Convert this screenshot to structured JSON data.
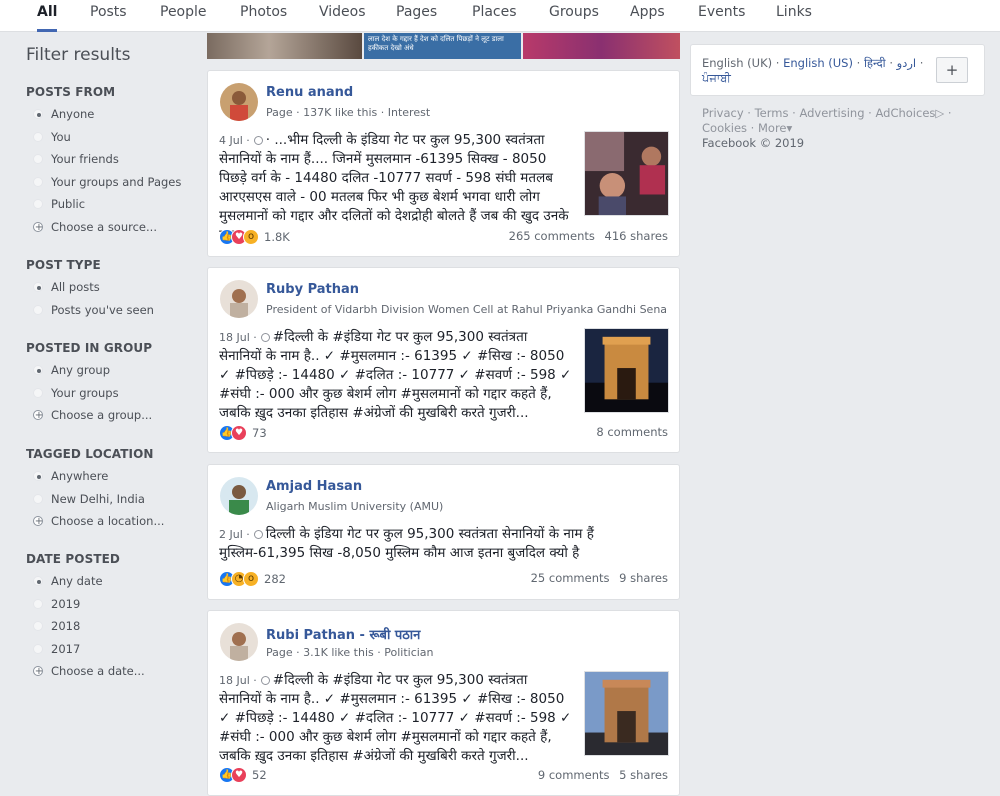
{
  "topnav": {
    "tabs": [
      "All",
      "Posts",
      "People",
      "Photos",
      "Videos",
      "Pages",
      "Places",
      "Groups",
      "Apps",
      "Events",
      "Links"
    ],
    "active": "All"
  },
  "sidebar": {
    "title": "Filter results",
    "posts_from": {
      "heading": "POSTS FROM",
      "options": [
        "Anyone",
        "You",
        "Your friends",
        "Your groups and Pages",
        "Public"
      ],
      "choose": "Choose a source..."
    },
    "post_type": {
      "heading": "POST TYPE",
      "options": [
        "All posts",
        "Posts you've seen"
      ]
    },
    "posted_in_group": {
      "heading": "POSTED IN GROUP",
      "options": [
        "Any group",
        "Your groups"
      ],
      "choose": "Choose a group..."
    },
    "tagged_location": {
      "heading": "TAGGED LOCATION",
      "options": [
        "Anywhere",
        "New Delhi, India"
      ],
      "choose": "Choose a location..."
    },
    "date_posted": {
      "heading": "DATE POSTED",
      "options": [
        "Any date",
        "2019",
        "2018",
        "2017"
      ],
      "choose": "Choose a date..."
    }
  },
  "banner": {
    "text": "लाल देश के गद्दार हैं देश को दलित पिछड़ों ने लूट डाला हकीकत देखो अंधे"
  },
  "posts": [
    {
      "name": "Renu anand",
      "meta": "Page · 137K like this · Interest",
      "date": "4 Jul ·",
      "text": "· ...भीम दिल्ली के इंडिया गेट पर कुल 95,300 स्वतंत्रता सेनानियों के नाम हैं.... जिनमें मुसलमान -61395 सिक्ख - 8050 पिछड़े वर्ग के - 14480 दलित -10777 सवर्ण - 598 संघी मतलब आरएसएस वाले - 00 मतलब फिर भी कुछ बेशर्म भगवा धारी लोग मुसलमानों को गद्दार और दलितों को देशद्रोही बोलते हैं जब की खुद उनके बाप...",
      "reaction_count": "1.8K",
      "comments": "265 comments",
      "shares": "416 shares"
    },
    {
      "name": "Ruby Pathan",
      "meta": "President of Vidarbh Division Women Cell at Rahul Priyanka Gandhi Sena",
      "date": "18 Jul ·",
      "text": "#दिल्ली के #इंडिया गेट पर कुल 95,300 स्वतंत्रता सेनानियों के नाम है.. ✓ #मुसलमान :- 61395 ✓ #सिख :- 8050 ✓ #पिछड़े :- 14480 ✓ #दलित :- 10777 ✓ #सवर्ण :- 598 ✓ #संघी :- 000 और कुछ बेशर्म लोग #मुसलमानों को गद्दार कहते हैं, जबकि ख़ुद उनका इतिहास #अंग्रेजों की मुखबिरी करते गुजरी...",
      "reaction_count": "73",
      "comments": "8 comments",
      "shares": ""
    },
    {
      "name": "Amjad Hasan",
      "meta": "Aligarh Muslim University (AMU)",
      "date": "2 Jul ·",
      "text": "दिल्ली के इंडिया गेट पर कुल 95,300 स्वतंत्रता सेनानियों के नाम हैं मुस्लिम-61,395 सिख -8,050 मुस्लिम कौम आज इतना बुजदिल क्यो है",
      "reaction_count": "282",
      "comments": "25 comments",
      "shares": "9 shares"
    },
    {
      "name": "Rubi Pathan - रूबी पठान",
      "meta": "Page · 3.1K like this · Politician",
      "date": "18 Jul ·",
      "text": "#दिल्ली के #इंडिया गेट पर कुल 95,300 स्वतंत्रता सेनानियों के नाम है.. ✓ #मुसलमान :- 61395 ✓ #सिख :- 8050 ✓ #पिछड़े :- 14480 ✓ #दलित :- 10777 ✓ #सवर्ण :- 598 ✓ #संघी :- 000 और कुछ बेशर्म लोग #मुसलमानों को गद्दार कहते हैं, जबकि ख़ुद उनका इतिहास #अंग्रेजों की मुखबिरी करते गुजरी...",
      "reaction_count": "52",
      "comments": "9 comments",
      "shares": "5 shares"
    }
  ],
  "rightcol": {
    "languages": {
      "current": "English (UK)",
      "sep1": " · ",
      "us": "English (US)",
      "sep2": " · ",
      "hindi": "हिन्दी",
      "sep3": " · ",
      "urdu": "اردو",
      "sep4": " ·",
      "punjabi": "ਪੰਜਾਬੀ"
    },
    "add_label": "+",
    "footer": {
      "privacy": "Privacy",
      "terms": "Terms",
      "advertising": "Advertising",
      "adchoices": "AdChoices",
      "adchoices_icon": "▷",
      "cookies": "Cookies",
      "more": "More",
      "more_caret": "▾",
      "copyright": "Facebook © 2019"
    }
  },
  "icons": {
    "accent": "#4267b2",
    "link": "#365899",
    "like": "#1877f2",
    "love": "#e9405a",
    "wow": "#f7b125"
  }
}
